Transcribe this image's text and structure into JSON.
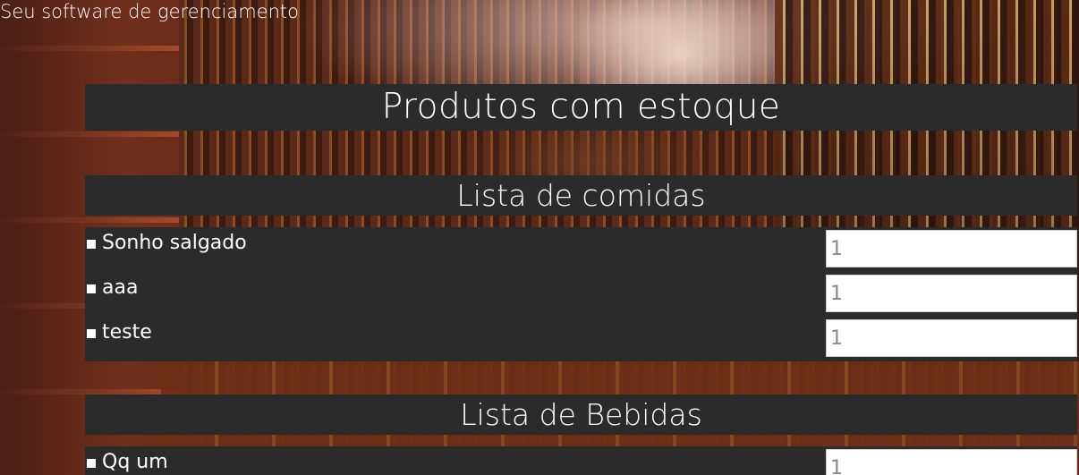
{
  "header": {
    "tagline": "Seu software de gerenciamento",
    "title": "Produtos com estoque"
  },
  "sections": {
    "food": {
      "title": "Lista de comidas",
      "items": [
        {
          "label": "Sonho salgado",
          "quantity": "1"
        },
        {
          "label": "aaa",
          "quantity": "1"
        },
        {
          "label": "teste",
          "quantity": "1"
        }
      ]
    },
    "drinks": {
      "title": "Lista de Bebidas",
      "items": [
        {
          "label": "Qq um",
          "quantity": "1"
        }
      ]
    }
  },
  "colors": {
    "panel": "#2b2b2b",
    "text": "#ffffff",
    "input_text": "#8a8a8a"
  }
}
